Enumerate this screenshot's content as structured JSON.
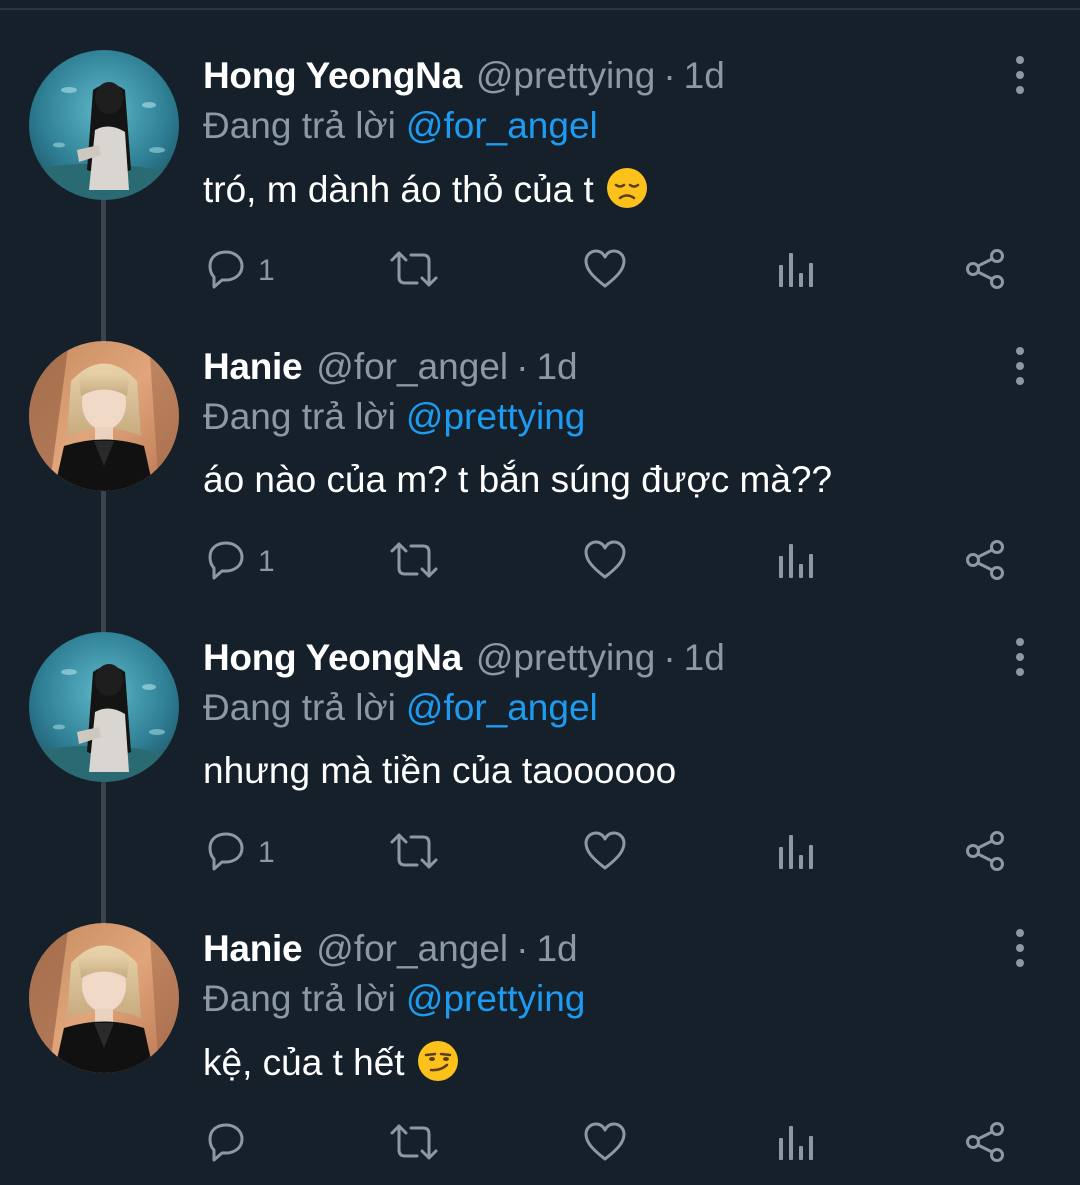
{
  "tweets": [
    {
      "display_name": "Hong YeongNa",
      "handle": "@prettying",
      "separator": "·",
      "time": "1d",
      "reply_prefix": "Đang trả lời",
      "reply_to": "@for_angel",
      "text": "tró, m dành áo thỏ của t",
      "emoji": "disappointed-face",
      "reply_count": "1",
      "avatar": "aquarium-girl-avatar"
    },
    {
      "display_name": "Hanie",
      "handle": "@for_angel",
      "separator": "·",
      "time": "1d",
      "reply_prefix": "Đang trả lời",
      "reply_to": "@prettying",
      "text": "áo nào của m? t bắn súng được mà??",
      "emoji": "",
      "reply_count": "1",
      "avatar": "blonde-person-avatar"
    },
    {
      "display_name": "Hong YeongNa",
      "handle": "@prettying",
      "separator": "·",
      "time": "1d",
      "reply_prefix": "Đang trả lời",
      "reply_to": "@for_angel",
      "text": "nhưng mà tiền của taoooooo",
      "emoji": "",
      "reply_count": "1",
      "avatar": "aquarium-girl-avatar"
    },
    {
      "display_name": "Hanie",
      "handle": "@for_angel",
      "separator": "·",
      "time": "1d",
      "reply_prefix": "Đang trả lời",
      "reply_to": "@prettying",
      "text": "kệ, của t hết",
      "emoji": "smirking-face",
      "reply_count": "",
      "avatar": "blonde-person-avatar"
    }
  ],
  "icons": {
    "reply": "reply-icon",
    "retweet": "retweet-icon",
    "like": "heart-icon",
    "views": "analytics-icon",
    "share": "share-icon",
    "more": "more-vertical-icon"
  },
  "colors": {
    "background": "#15202b",
    "text": "#ffffff",
    "secondary": "#8b98a5",
    "link": "#1d9bf0",
    "thread_line": "#3a444c"
  }
}
